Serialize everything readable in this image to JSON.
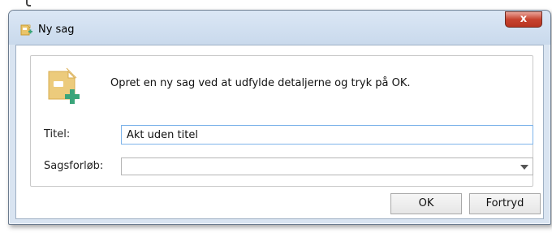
{
  "window": {
    "title": "Ny sag",
    "close_glyph": "x",
    "app_icon": "new-case-icon"
  },
  "dialog": {
    "intro_text": "Opret en ny sag ved at udfylde detaljerne og tryk på OK.",
    "big_icon": "new-case-plus-icon",
    "fields": {
      "title_label": "Titel:",
      "title_value": "Akt uden titel",
      "process_label": "Sagsforløb:",
      "process_value": ""
    },
    "buttons": {
      "ok_label": "OK",
      "cancel_label": "Fortryd"
    }
  },
  "colors": {
    "icon_folder": "#e9c46a",
    "icon_plus": "#3aa57a",
    "input_focus_border": "#7eb4ea",
    "close_button": "#c7432f"
  }
}
